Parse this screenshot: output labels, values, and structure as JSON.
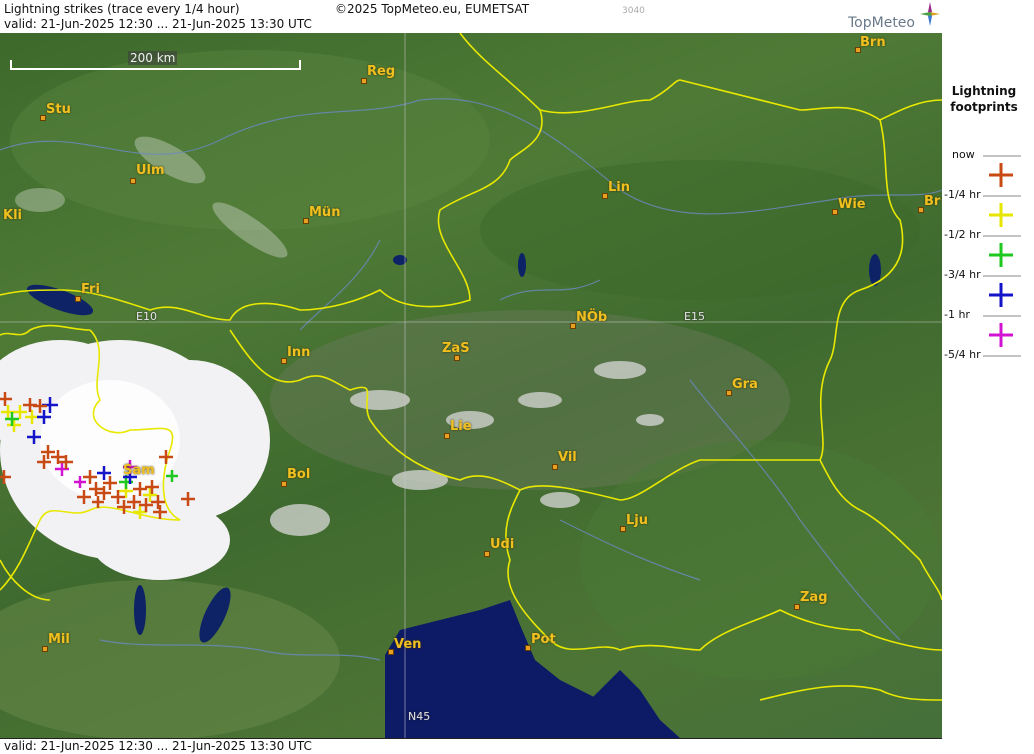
{
  "header": {
    "title": "Lightning strikes (trace every 1/4 hour)",
    "copyright": "©2025 TopMeteo.eu, EUMETSAT",
    "code": "3040",
    "valid": "valid:  21-Jun-2025 12:30 ... 21-Jun-2025 13:30 UTC",
    "logo_text": "TopMeteo"
  },
  "footer": {
    "valid": "valid:  21-Jun-2025 12:30 ... 21-Jun-2025 13:30 UTC"
  },
  "map": {
    "scale_label": "200 km",
    "grid_labels": {
      "e10": "E10",
      "e15": "E15",
      "n45": "N45"
    },
    "cities": {
      "brn": "Brn",
      "reg": "Reg",
      "stu": "Stu",
      "ulm": "Ulm",
      "mun": "Mün",
      "kli": "Kli",
      "lin": "Lin",
      "wie": "Wie",
      "br": "Br",
      "fri": "Fri",
      "nob": "NÖb",
      "inn": "Inn",
      "zas": "ZaS",
      "gra": "Gra",
      "lie": "Lie",
      "vil": "Vil",
      "bol": "Bol",
      "sam": "Sam",
      "lju": "Lju",
      "udi": "Udi",
      "zag": "Zag",
      "mil": "Mil",
      "ven": "Ven",
      "pot": "Pot"
    }
  },
  "legend": {
    "title": "Lightning footprints",
    "items": [
      {
        "label": "now",
        "color": "#c84a14"
      },
      {
        "label": "-1/4 hr",
        "color": "#e6e600"
      },
      {
        "label": "-1/2 hr",
        "color": "#1ec81e"
      },
      {
        "label": "-3/4 hr",
        "color": "#1414c8"
      },
      {
        "label": "-1 hr",
        "color": "#d214d2"
      },
      {
        "label": "-5/4 hr",
        "color": ""
      }
    ]
  }
}
